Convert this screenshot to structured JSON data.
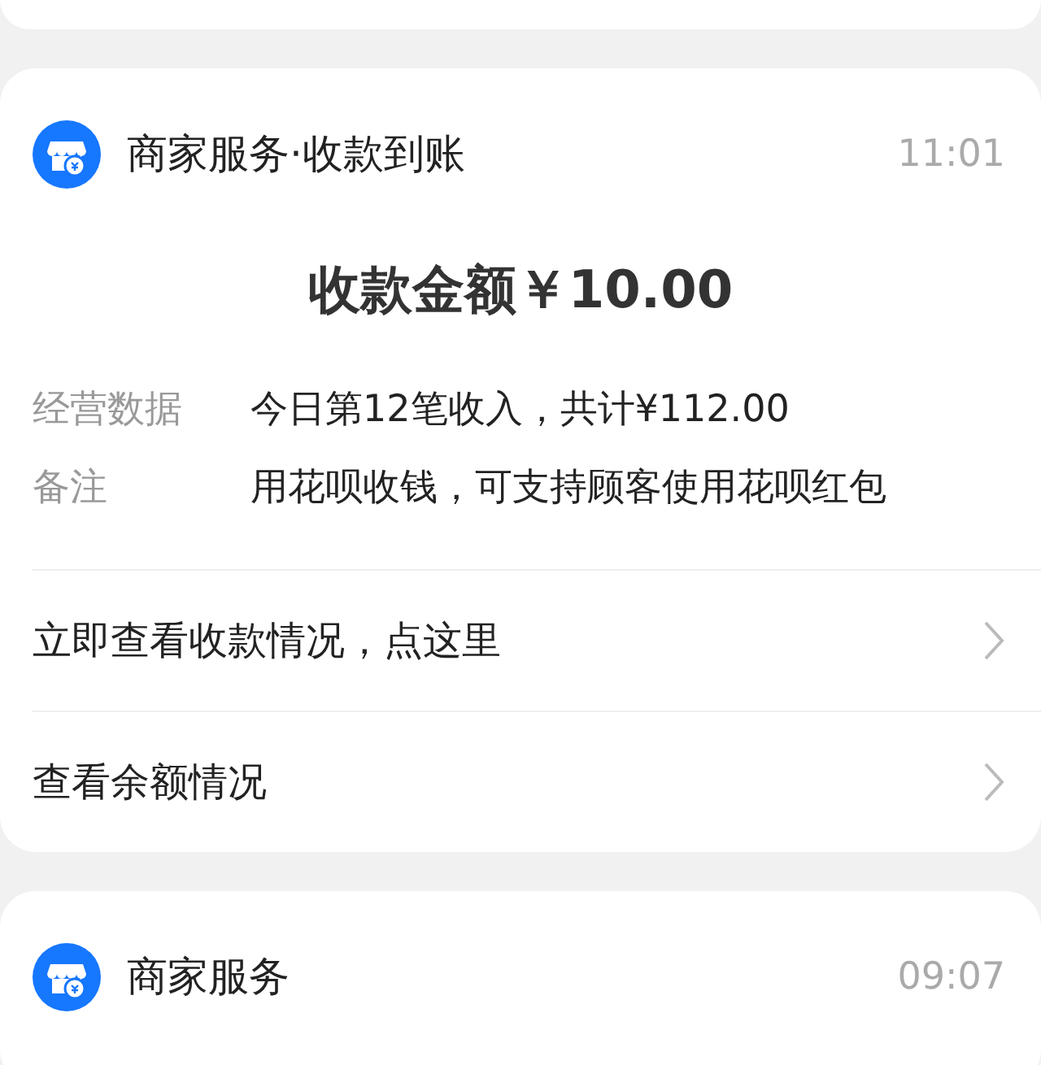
{
  "cards": [
    {
      "kind": "detail",
      "app": "商家服务·收款到账",
      "time": "11:01",
      "headline": "收款金额￥10.00",
      "fields": [
        {
          "label": "经营数据",
          "value": "今日第12笔收入，共计¥112.00"
        },
        {
          "label": "备注",
          "value": "用花呗收钱，可支持顾客使用花呗红包"
        }
      ],
      "links": [
        "立即查看收款情况，点这里",
        "查看余额情况"
      ]
    },
    {
      "kind": "brief",
      "app": "商家服务",
      "time": "09:07"
    }
  ]
}
